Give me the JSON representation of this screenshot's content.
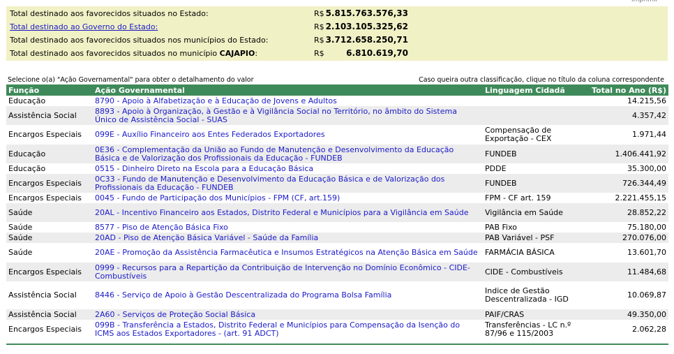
{
  "header": {
    "print_label": "imprimir"
  },
  "summary": [
    {
      "label": "Total destinado aos favorecidos situados no Estado:",
      "is_link": false,
      "bold_suffix": "",
      "currency": "R$",
      "value": "5.815.763.576,33"
    },
    {
      "label": "Total destinado ao Governo do Estado:",
      "is_link": true,
      "bold_suffix": "",
      "currency": "R$",
      "value": "2.103.105.325,62"
    },
    {
      "label": "Total destinado aos favorecidos situados nos municípios do Estado:",
      "is_link": false,
      "bold_suffix": "",
      "currency": "R$",
      "value": "3.712.658.250,71"
    },
    {
      "label": "Total destinado aos favorecidos situados no município ",
      "is_link": false,
      "bold_suffix": "CAJAPIO",
      "label_end": ":",
      "currency": "R$",
      "value": "6.810.619,70"
    }
  ],
  "hints": {
    "left": "Selecione o(a) \"Ação Governamental\" para obter o detalhamento do valor",
    "right": "Caso queira outra classificação, clique no título da coluna correspondente"
  },
  "table": {
    "headers": {
      "funcao": "Função",
      "acao": "Ação Governamental",
      "linguagem": "Linguagem Cidadã",
      "total": "Total no Ano (R$)"
    },
    "rows": [
      {
        "funcao": "Educação",
        "acao": "8790 - Apoio à Alfabetização e à Educação de Jovens e Adultos",
        "linguagem": "",
        "total": "14.215,56",
        "h": 15
      },
      {
        "funcao": "Assistência Social",
        "acao": "8893 - Apoio à Organização, à Gestão e à Vigilância Social no Território, no âmbito do Sistema Único de Assistência Social - SUAS",
        "linguagem": "",
        "total": "4.357,42",
        "h": 27
      },
      {
        "funcao": "Encargos Especiais",
        "acao": "099E - Auxílio Financeiro aos Entes Federados Exportadores",
        "linguagem": "Compensação de Exportação - CEX",
        "total": "1.971,44",
        "h": 28
      },
      {
        "funcao": "Educação",
        "acao": "0E36 - Complementação da União ao Fundo de Manutenção e Desenvolvimento da Educação Básica e de Valorização dos Profissionais da Educação - FUNDEB",
        "linguagem": "FUNDEB",
        "total": "1.406.441,92",
        "h": 27
      },
      {
        "funcao": "Educação",
        "acao": "0515 - Dinheiro Direto na Escola para a Educação Básica",
        "linguagem": "PDDE",
        "total": "35.300,00",
        "h": 15
      },
      {
        "funcao": "Encargos Especiais",
        "acao": "0C33 - Fundo de Manutenção e Desenvolvimento da Educação Básica e de Valorização dos Profissionais da Educação - FUNDEB",
        "linguagem": "FUNDEB",
        "total": "726.344,49",
        "h": 27
      },
      {
        "funcao": "Encargos Especiais",
        "acao": "0045 - Fundo de Participação dos Municípios - FPM (CF, art.159)",
        "linguagem": "FPM - CF art. 159",
        "total": "2.221.455,15",
        "h": 15
      },
      {
        "funcao": "Saúde",
        "acao": "20AL - Incentivo Financeiro aos Estados, Distrito Federal e Municípios para a Vigilância em Saúde",
        "linguagem": "Vigilância em Saúde",
        "total": "28.852,22",
        "h": 27
      },
      {
        "funcao": "Saúde",
        "acao": "8577 - Piso de Atenção Básica Fixo",
        "linguagem": "PAB Fixo",
        "total": "75.180,00",
        "h": 15
      },
      {
        "funcao": "Saúde",
        "acao": "20AD - Piso de Atenção Básica Variável - Saúde da Família",
        "linguagem": "PAB Variável - PSF",
        "total": "270.076,00",
        "h": 15
      },
      {
        "funcao": "Saúde",
        "acao": "20AE - Promoção da Assistência Farmacêutica e Insumos Estratégicos na Atenção Básica em Saúde",
        "linguagem": "FARMÁCIA BÁSICA",
        "total": "13.601,70",
        "h": 28
      },
      {
        "funcao": "Encargos Especiais",
        "acao": "0999 - Recursos para a Repartição da Contribuição de Intervenção no Domínio Econômico - CIDE-Combustíveis",
        "linguagem": "CIDE - Combustíveis",
        "total": "11.484,68",
        "h": 27
      },
      {
        "funcao": "Assistência Social",
        "acao": "8446 - Serviço de Apoio à Gestão Descentralizada do Programa Bolsa Família",
        "linguagem": "Indice de Gestão Descentralizada - IGD",
        "total": "10.069,87",
        "h": 40
      },
      {
        "funcao": "Assistência Social",
        "acao": "2A60 - Serviços de Proteção Social Básica",
        "linguagem": "PAIF/CRAS",
        "total": "49.350,00",
        "h": 15
      },
      {
        "funcao": "Encargos Especiais",
        "acao": "099B - Transferência a Estados, Distrito Federal e Municípios para Compensação da Isenção do ICMS aos Estados Exportadores - (art. 91 ADCT)",
        "linguagem": "Transferências - LC n.º 87/96 e 115/2003",
        "total": "2.062,28",
        "h": 27
      }
    ]
  }
}
